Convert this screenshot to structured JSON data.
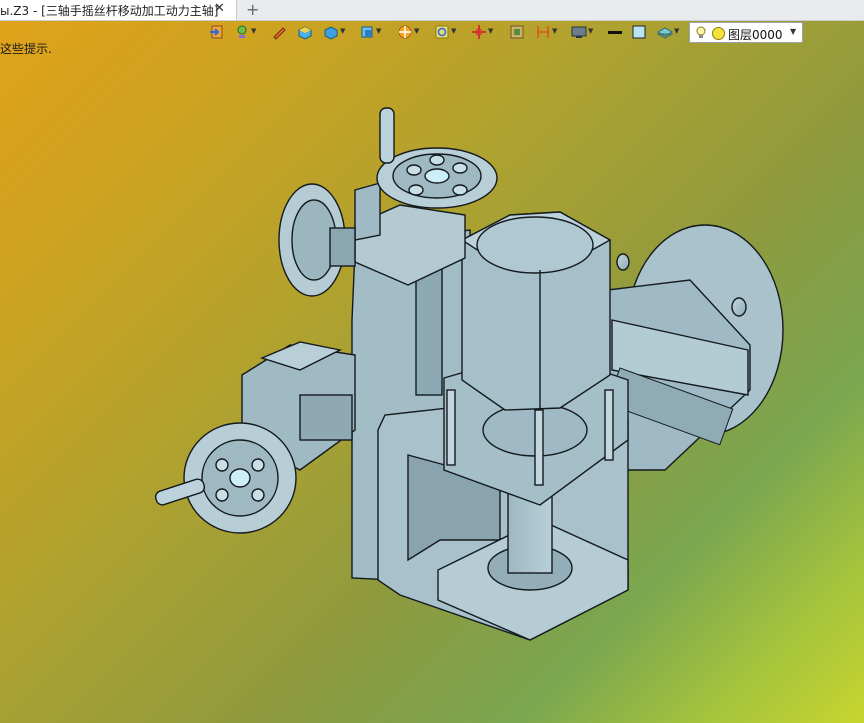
{
  "tab": {
    "title": "ы.Z3 - [三轴手摇丝杆移动加工动力主轴]",
    "close": "✕",
    "add": "+"
  },
  "hint": "这些提示.",
  "toolbar": {
    "icons": [
      "import-icon",
      "light-bulb-icon",
      "pencil-icon",
      "solid-box-icon",
      "shaded-cube-icon",
      "view-cube-icon",
      "sun-filter-icon",
      "zoom-icon",
      "move-axis-icon",
      "frame-icon",
      "dimension-icon",
      "display-icon",
      "line-color-icon",
      "face-color-icon",
      "layer-stack-icon"
    ]
  },
  "layer": {
    "label": "图层0000"
  },
  "colors": {
    "model": "#a9c2cc",
    "edge": "#141a1e",
    "bg_top": "#e2a21a",
    "bg_bottom": "#c7d52e"
  }
}
